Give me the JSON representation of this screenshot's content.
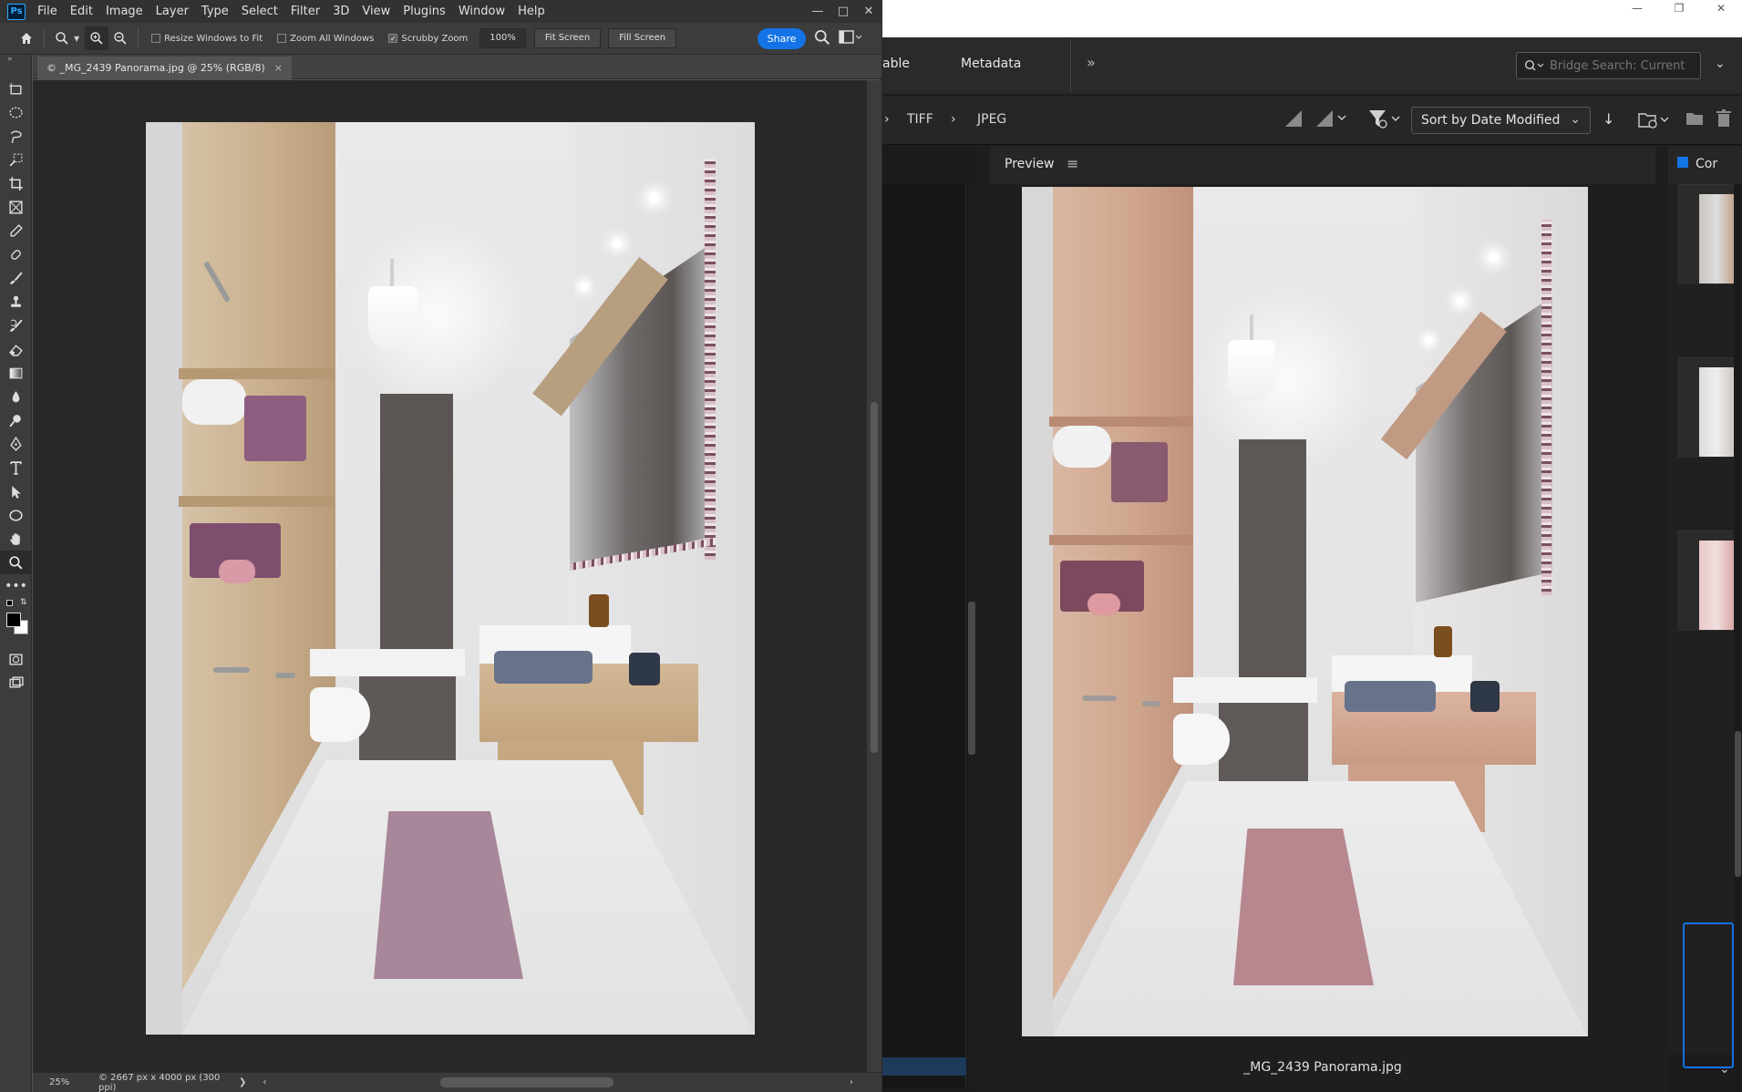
{
  "photoshop": {
    "menu": [
      "File",
      "Edit",
      "Image",
      "Layer",
      "Type",
      "Select",
      "Filter",
      "3D",
      "View",
      "Plugins",
      "Window",
      "Help"
    ],
    "logo_text": "Ps",
    "options": {
      "resize_windows": "Resize Windows to Fit",
      "resize_windows_checked": false,
      "zoom_all": "Zoom All Windows",
      "zoom_all_checked": false,
      "scrubby_zoom": "Scrubby Zoom",
      "scrubby_zoom_checked": true,
      "zoom_value": "100%",
      "fit_screen": "Fit Screen",
      "fill_screen": "Fill Screen",
      "share": "Share"
    },
    "document_tab": "© _MG_2439 Panorama.jpg @ 25% (RGB/8)",
    "tab_close": "×",
    "status": {
      "zoom": "25%",
      "info": "© 2667 px x 4000 px (300 ppi)",
      "arrow": "❯"
    }
  },
  "bridge": {
    "tabs": {
      "partial_left": "able",
      "metadata": "Metadata",
      "more": "»"
    },
    "search_placeholder": "Bridge Search: Current I",
    "breadcrumbs": [
      "TIFF",
      "JPEG"
    ],
    "sort": "Sort by Date Modified",
    "preview_title": "Preview",
    "preview_filename": "_MG_2439 Panorama.jpg",
    "content_title": "Cor"
  },
  "colors": {
    "accent": "#1473e6",
    "ps_bg": "#535353",
    "canvas_bg": "#282828",
    "bridge_bg": "#1e1e1e"
  }
}
